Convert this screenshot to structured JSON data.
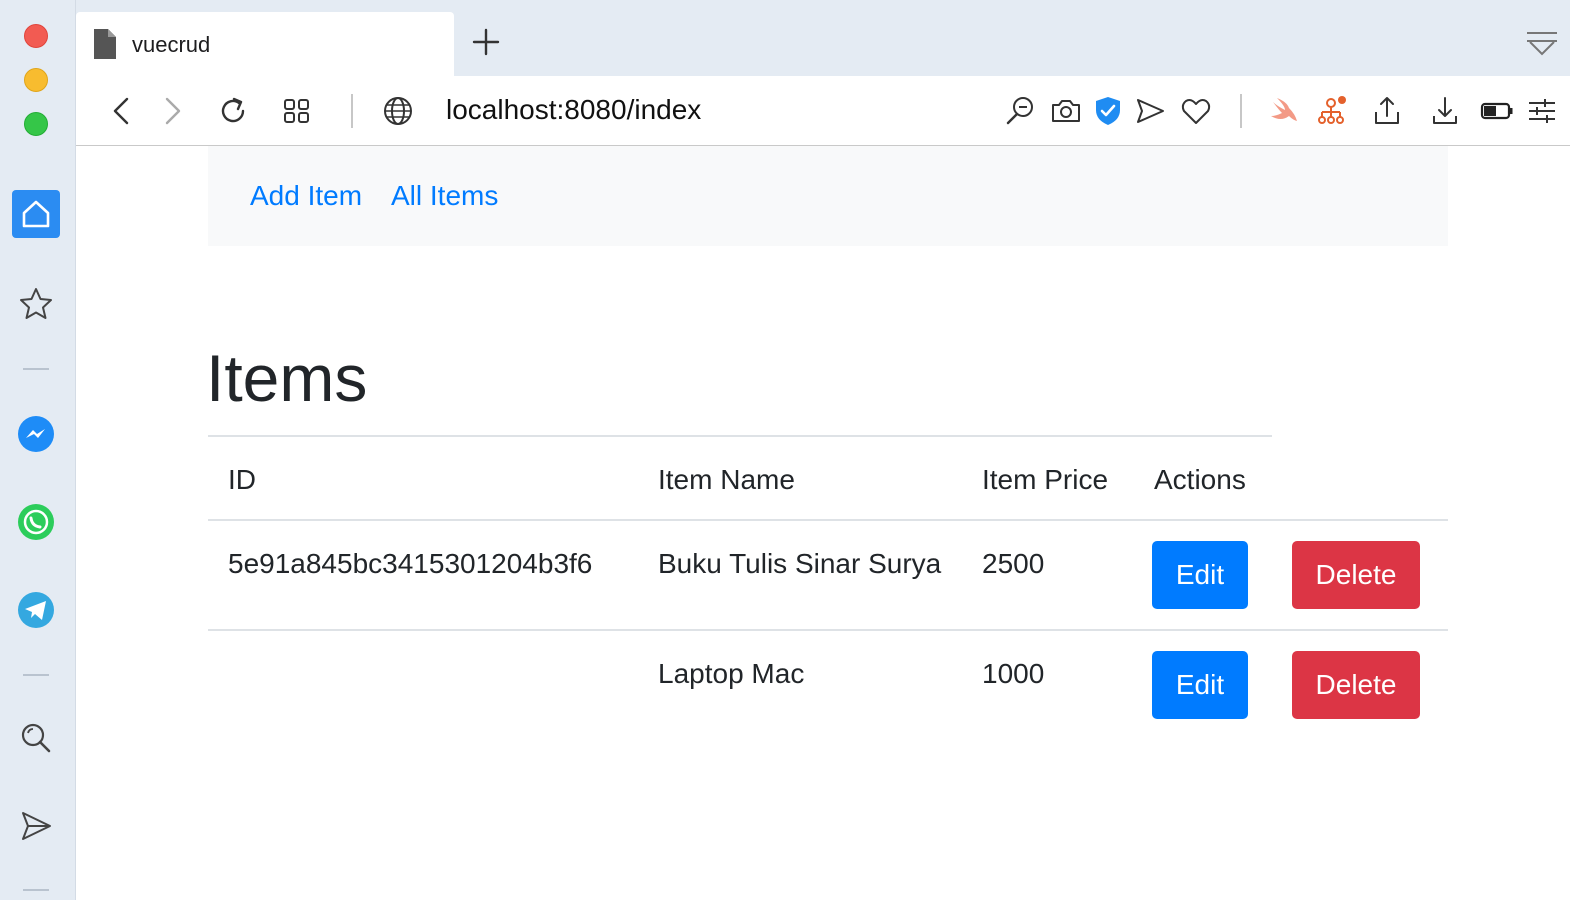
{
  "browser": {
    "tab_title": "vuecrud",
    "address": "localhost:8080/index"
  },
  "nav": {
    "add_item": "Add Item",
    "all_items": "All Items"
  },
  "page": {
    "title": "Items"
  },
  "table": {
    "headers": [
      "ID",
      "Item Name",
      "Item Price",
      "Actions"
    ],
    "rows": [
      {
        "id": "5e91a845bc3415301204b3f6",
        "name": "Buku Tulis Sinar Surya",
        "price": "2500",
        "edit": "Edit",
        "delete": "Delete"
      },
      {
        "id": "",
        "name": "Laptop Mac",
        "price": "1000",
        "edit": "Edit",
        "delete": "Delete"
      }
    ]
  },
  "colors": {
    "link": "#007bff",
    "edit_button": "#007bff",
    "delete_button": "#dc3545",
    "sidebar_active": "#2b8cf2"
  },
  "icons": {
    "sidebar": [
      "home-icon",
      "star-icon",
      "messenger-icon",
      "whatsapp-icon",
      "telegram-icon",
      "search-icon",
      "send-icon"
    ],
    "toolbar": [
      "back-icon",
      "forward-icon",
      "reload-icon",
      "tabs-grid-icon",
      "globe-icon",
      "zoom-out-icon",
      "camera-icon",
      "shield-check-icon",
      "send-icon",
      "heart-icon",
      "swift-icon",
      "sitemap-icon",
      "share-icon",
      "download-icon",
      "battery-icon",
      "settings-icon"
    ]
  }
}
